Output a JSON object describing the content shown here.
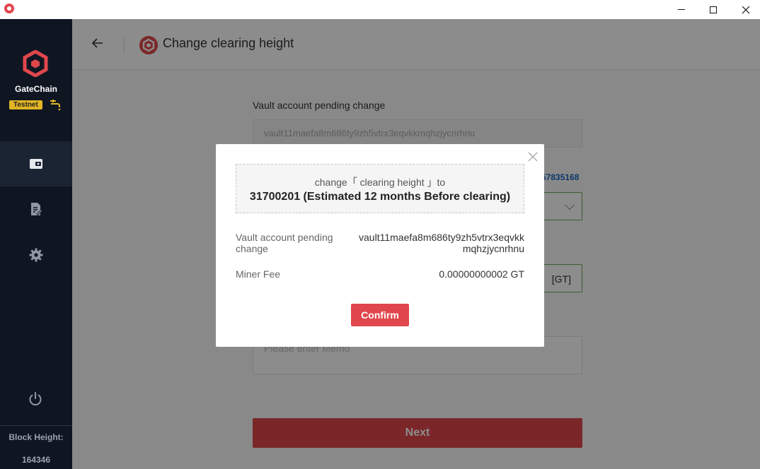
{
  "app": {
    "brand": "GateChain",
    "network_badge": "Testnet",
    "accent_color": "#e0474c"
  },
  "window": {
    "minimize_icon": "minimize-icon",
    "maximize_icon": "maximize-icon",
    "close_icon": "close-icon"
  },
  "sidebar": {
    "items": [
      {
        "icon": "wallet-icon",
        "active": true
      },
      {
        "icon": "document-edit-icon",
        "active": false
      },
      {
        "icon": "gear-icon",
        "active": false
      }
    ],
    "block_height_label": "Block Height:",
    "block_height_value": "164346"
  },
  "header": {
    "title": "Change clearing height"
  },
  "form": {
    "vault_label": "Vault account pending change",
    "vault_value": "vault11maefa8m686ty9zh5vtrx3eqvkkmqhzjycnrhnu",
    "link_value_fragment": "57835168",
    "amount_unit": "[GT]",
    "memo_placeholder": "Please enter Memo",
    "next_label": "Next"
  },
  "modal": {
    "notice_line1": "change「 clearing height 」to",
    "notice_line2": "31700201 (Estimated 12 months Before clearing)",
    "rows": [
      {
        "label": "Vault account pending change",
        "value": "vault11maefa8m686ty9zh5vtrx3eqvkkmqhzjycnrhnu"
      },
      {
        "label": "Miner Fee",
        "value": "0.00000000002 GT"
      }
    ],
    "confirm_label": "Confirm"
  }
}
